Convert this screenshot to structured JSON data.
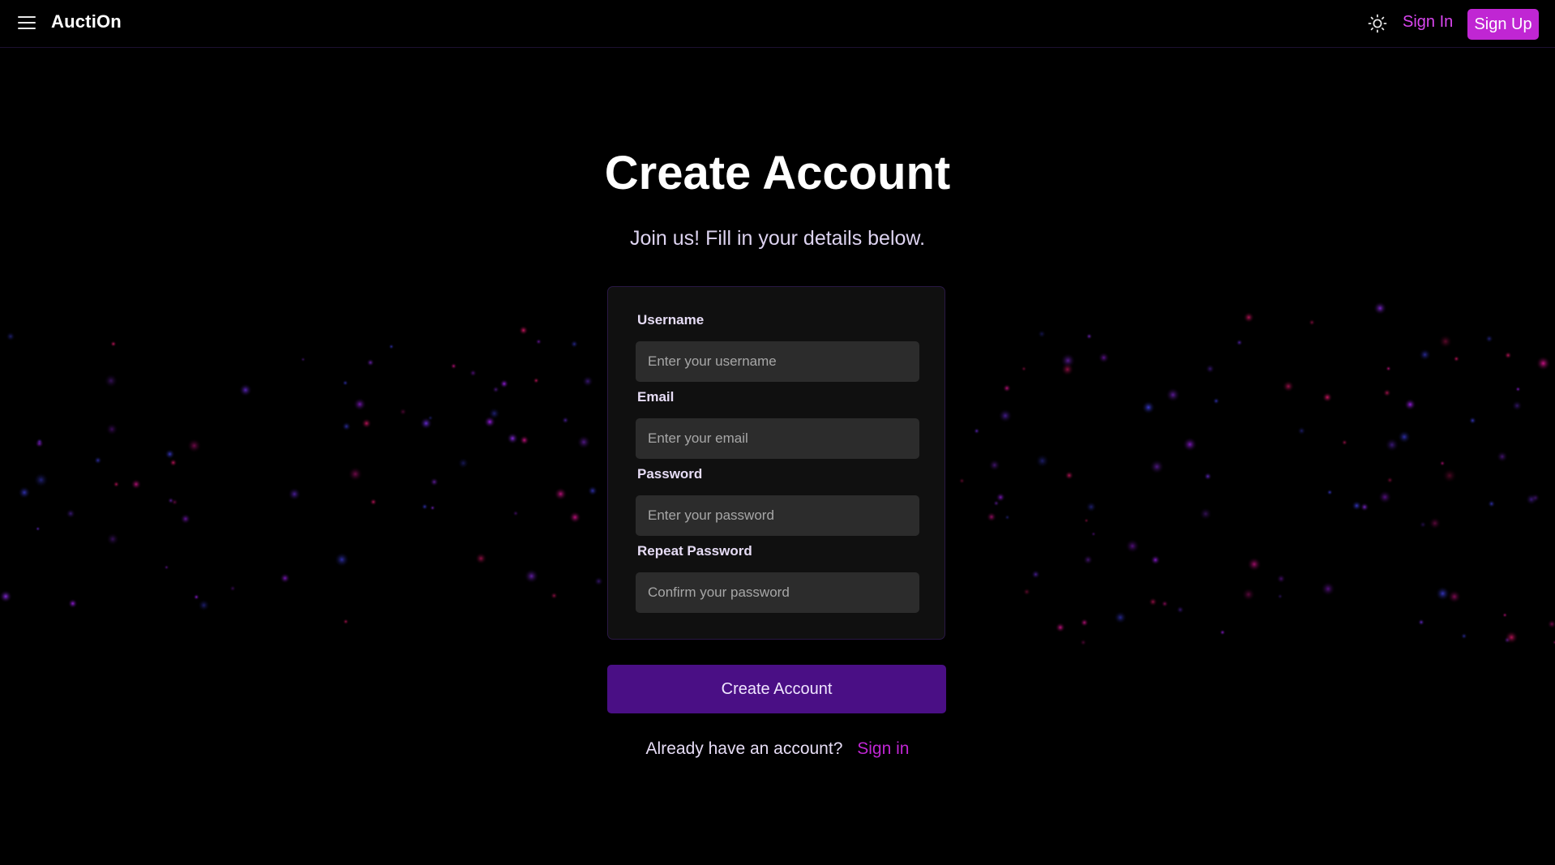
{
  "header": {
    "brand": "AuctiOn",
    "menu_icon": "hamburger-menu-icon",
    "theme_icon": "sun-icon",
    "sign_in_label": "Sign In",
    "sign_up_label": "Sign Up"
  },
  "main": {
    "title": "Create Account",
    "subtitle": "Join us! Fill in your details below.",
    "form": {
      "username": {
        "label": "Username",
        "value": "",
        "placeholder": "Enter your username"
      },
      "email": {
        "label": "Email",
        "value": "",
        "placeholder": "Enter your email"
      },
      "password": {
        "label": "Password",
        "value": "",
        "placeholder": "Enter your password"
      },
      "repeat_password": {
        "label": "Repeat Password",
        "value": "",
        "placeholder": "Confirm your password"
      }
    },
    "submit_label": "Create Account",
    "signin_prompt": {
      "text": "Already have an account?",
      "link_label": "Sign in"
    }
  },
  "colors": {
    "background": "#000000",
    "accent": "#c026d3",
    "button": "#4a0f85",
    "card": "#101010",
    "input": "#2c2c2c"
  }
}
